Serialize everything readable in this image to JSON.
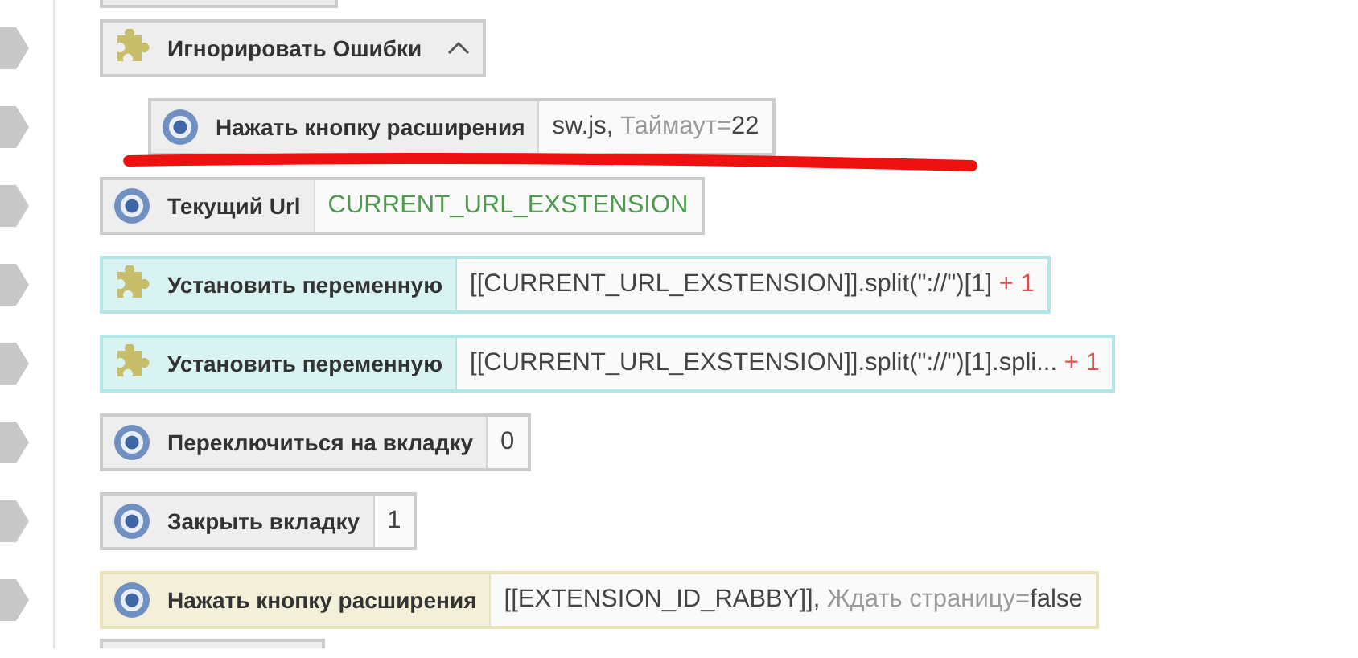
{
  "actions": [
    {
      "title": "Игнорировать Ошибки",
      "kind": "flow",
      "selected": false,
      "expanded": true,
      "children": [
        {
          "title": "Нажать кнопку расширения",
          "kind": "browser",
          "selected": false,
          "params": [
            {
              "kind": "value",
              "text": "sw.js, "
            },
            {
              "kind": "key",
              "text": "Таймаут="
            },
            {
              "kind": "value",
              "text": "22"
            }
          ],
          "highlighted": true
        }
      ]
    },
    {
      "title": "Текущий Url",
      "kind": "browser",
      "selected": false,
      "params": [
        {
          "kind": "variable",
          "text": "CURRENT_URL_EXSTENSION"
        }
      ]
    },
    {
      "title": "Установить переменную",
      "kind": "variable",
      "selected": false,
      "params": [
        {
          "kind": "value",
          "text": "[[CURRENT_URL_EXSTENSION]].split(\"://\")[1]"
        },
        {
          "kind": "count",
          "text": " + 1"
        }
      ]
    },
    {
      "title": "Установить переменную",
      "kind": "variable",
      "selected": false,
      "params": [
        {
          "kind": "value",
          "text": "[[CURRENT_URL_EXSTENSION]].split(\"://\")[1].spli..."
        },
        {
          "kind": "count",
          "text": " + 1"
        }
      ]
    },
    {
      "title": "Переключиться на вкладку",
      "kind": "browser",
      "selected": false,
      "params": [
        {
          "kind": "value",
          "text": "0"
        }
      ]
    },
    {
      "title": "Закрыть вкладку",
      "kind": "browser",
      "selected": false,
      "params": [
        {
          "kind": "value",
          "text": "1"
        }
      ]
    },
    {
      "title": "Нажать кнопку расширения",
      "kind": "browser",
      "selected": true,
      "params": [
        {
          "kind": "value",
          "text": "[[EXTENSION_ID_RABBY]], "
        },
        {
          "kind": "key",
          "text": "Ждать страницу="
        },
        {
          "kind": "value",
          "text": "false"
        }
      ]
    }
  ]
}
